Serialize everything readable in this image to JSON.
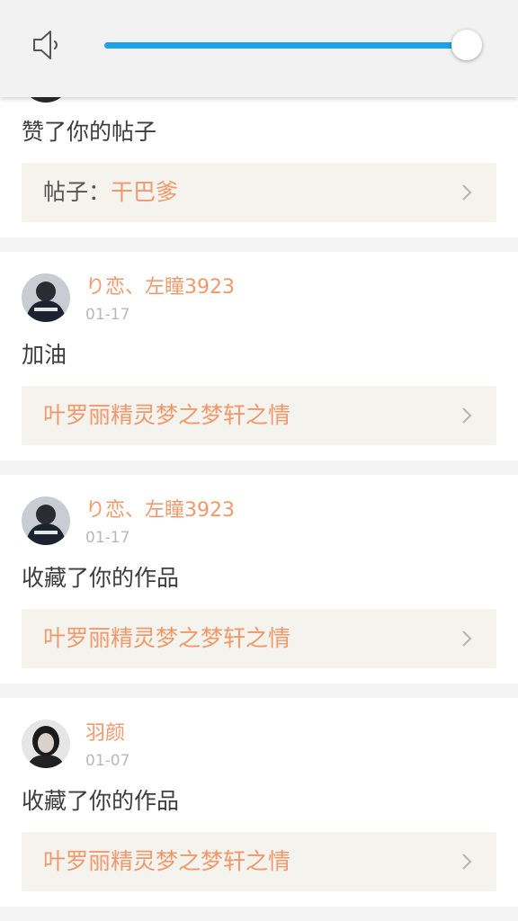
{
  "volume": {
    "icon": "speaker-icon",
    "level": 0.96,
    "accent": "#1fa1e8"
  },
  "notifications": [
    {
      "action": "赞了你的帖子",
      "ref_prefix": "帖子：",
      "ref_title": "干巴爹"
    },
    {
      "username": "り恋、左瞳3923",
      "date": "01-17",
      "action": "加油",
      "ref_prefix": "",
      "ref_title": "叶罗丽精灵梦之梦轩之情"
    },
    {
      "username": "り恋、左瞳3923",
      "date": "01-17",
      "action": "收藏了你的作品",
      "ref_prefix": "",
      "ref_title": "叶罗丽精灵梦之梦轩之情"
    },
    {
      "username": "羽颜",
      "date": "01-07",
      "action": "收藏了你的作品",
      "ref_prefix": "",
      "ref_title": "叶罗丽精灵梦之梦轩之情"
    }
  ],
  "colors": {
    "username": "#f0996b",
    "ref_title": "#f0996b",
    "ref_bg": "#f4f3ee",
    "date": "#b9b9b9"
  }
}
